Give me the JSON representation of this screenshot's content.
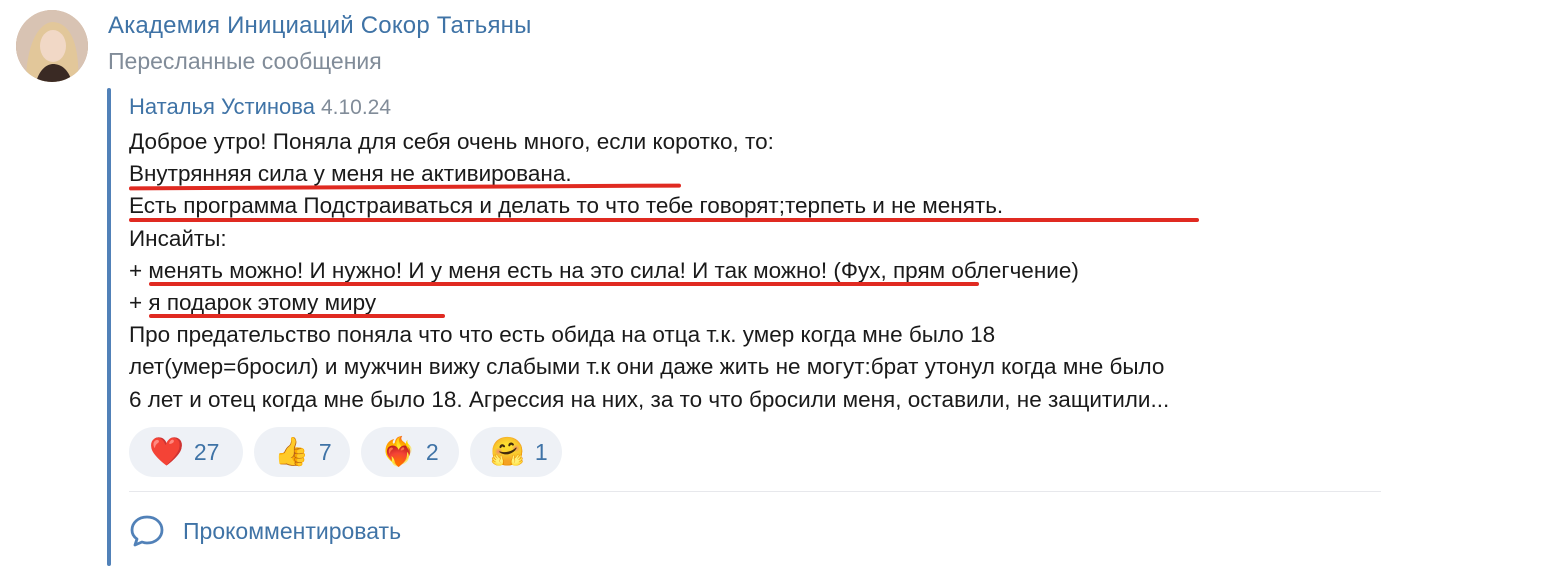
{
  "post": {
    "channel_name": "Академия Инициаций Сокор Татьяны",
    "subtitle": "Пересланные сообщения"
  },
  "forwarded": {
    "author": "Наталья Устинова",
    "date": "4.10.24",
    "lines": [
      "Доброе утро! Поняла для себя очень много, если коротко, то:",
      "Внутрянняя сила у меня не активирована.",
      "Есть программа Подстраиваться и делать то что тебе говорят;терпеть и не менять.",
      "Инсайты:",
      "+ менять можно! И нужно! И у меня есть на это сила! И так можно! (Фух, прям облегчение)",
      "+ я подарок этому миру",
      "Про предательство поняла что что есть обида на отца т.к. умер когда мне было 18",
      "лет(умер=бросил) и мужчин вижу слабыми т.к они даже жить не могут:брат утонул когда мне было",
      "6 лет и отец когда мне было 18. Агрессия на них, за то что бросили меня, оставили, не защитили..."
    ]
  },
  "reactions": [
    {
      "icon": "red-heart-icon",
      "emoji": "❤️",
      "count": "27"
    },
    {
      "icon": "thumbs-up-icon",
      "emoji": "👍",
      "count": "7"
    },
    {
      "icon": "heart-on-fire-icon",
      "emoji": "❤️‍🔥",
      "count": "2"
    },
    {
      "icon": "hugging-face-icon",
      "emoji": "🤗",
      "count": "1"
    }
  ],
  "actions": {
    "comment_label": "Прокомментировать"
  },
  "colors": {
    "link": "#3f73a6",
    "muted": "#818c99",
    "quote_bar": "#5181b8",
    "underline": "#e02a21",
    "reaction_bg": "#eef1f6"
  }
}
